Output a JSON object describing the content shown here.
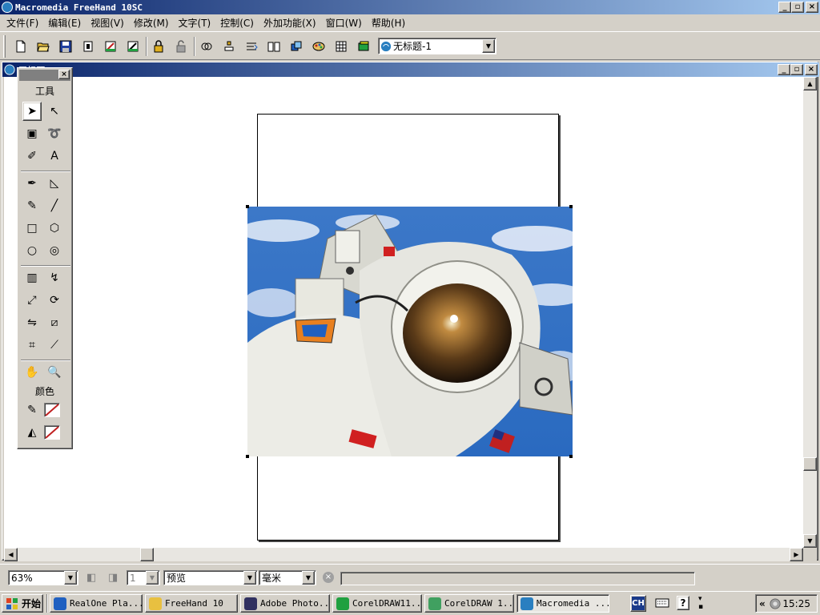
{
  "window": {
    "title": "Macromedia FreeHand 10SC",
    "controls": [
      "_",
      "▫",
      "×"
    ]
  },
  "menu": [
    "文件(F)",
    "编辑(E)",
    "视图(V)",
    "修改(M)",
    "文字(T)",
    "控制(C)",
    "外加功能(X)",
    "窗口(W)",
    "帮助(H)"
  ],
  "toolbar": {
    "document_select": "无标题-1",
    "buttons": [
      "new-icon",
      "open-icon",
      "save-icon",
      "import-icon",
      "export-icon",
      "export-2-icon",
      "lock-icon",
      "unlock-icon",
      "group-icon",
      "align-icon",
      "text-flow-icon",
      "book-icon",
      "layers-icon",
      "color-mixer-icon",
      "table-icon",
      "swatches-icon"
    ]
  },
  "document": {
    "title": "无标题",
    "controls": [
      "_",
      "▫",
      "×"
    ]
  },
  "palette": {
    "tools_label": "工具",
    "colors_label": "颜色",
    "close": "×",
    "tools": [
      {
        "name": "pointer-tool-icon",
        "glyph": "➤"
      },
      {
        "name": "subselect-tool-icon",
        "glyph": "↖"
      },
      {
        "name": "page-tool-icon",
        "glyph": "▣"
      },
      {
        "name": "lasso-tool-icon",
        "glyph": "➰"
      },
      {
        "name": "eyedropper-tool-icon",
        "glyph": "✐"
      },
      {
        "name": "text-tool-icon",
        "glyph": "A"
      },
      {
        "name": "pen-tool-icon",
        "glyph": "✒"
      },
      {
        "name": "bezigon-tool-icon",
        "glyph": "◺"
      },
      {
        "name": "pencil-tool-icon",
        "glyph": "✎"
      },
      {
        "name": "line-tool-icon",
        "glyph": "╱"
      },
      {
        "name": "rectangle-tool-icon",
        "glyph": "□"
      },
      {
        "name": "polygon-tool-icon",
        "glyph": "⬡"
      },
      {
        "name": "ellipse-tool-icon",
        "glyph": "○"
      },
      {
        "name": "spiral-tool-icon",
        "glyph": "◎"
      },
      {
        "name": "blend-tool-icon",
        "glyph": "▥"
      },
      {
        "name": "freeform-tool-icon",
        "glyph": "↯"
      },
      {
        "name": "scale-tool-icon",
        "glyph": "⤢"
      },
      {
        "name": "rotate-tool-icon",
        "glyph": "⟳"
      },
      {
        "name": "reflect-tool-icon",
        "glyph": "⇋"
      },
      {
        "name": "skew-tool-icon",
        "glyph": "⧄"
      },
      {
        "name": "trace-tool-icon",
        "glyph": "⌗"
      },
      {
        "name": "knife-tool-icon",
        "glyph": "⟋"
      },
      {
        "name": "hand-tool-icon",
        "glyph": "✋"
      },
      {
        "name": "zoom-tool-icon",
        "glyph": "🔍"
      }
    ],
    "color_rows": [
      {
        "name": "stroke-color-icon",
        "glyph": "✎"
      },
      {
        "name": "fill-color-icon",
        "glyph": "◭"
      }
    ]
  },
  "statusbar": {
    "zoom": "63%",
    "page_number": "1",
    "view_mode": "预览",
    "units": "毫米"
  },
  "taskbar": {
    "start": "开始",
    "tasks": [
      {
        "name": "task-realone",
        "label": "RealOne Pla...",
        "icon_color": "#2060c0"
      },
      {
        "name": "task-freehand-folder",
        "label": "FreeHand 10",
        "icon_color": "#e8c040"
      },
      {
        "name": "task-photoshop",
        "label": "Adobe Photo...",
        "icon_color": "#303060"
      },
      {
        "name": "task-coreldraw-11",
        "label": "CorelDRAW11...",
        "icon_color": "#20a040"
      },
      {
        "name": "task-coreldraw-1",
        "label": "CorelDRAW 1...",
        "icon_color": "#40a060"
      },
      {
        "name": "task-macromedia",
        "label": "Macromedia ...",
        "icon_color": "#2a7fc0",
        "active": true
      }
    ],
    "lang": "CH",
    "clock": "15:25"
  },
  "colors": {
    "title_active_start": "#0a246a",
    "title_active_end": "#a6caf0",
    "face": "#d4d0c8"
  }
}
